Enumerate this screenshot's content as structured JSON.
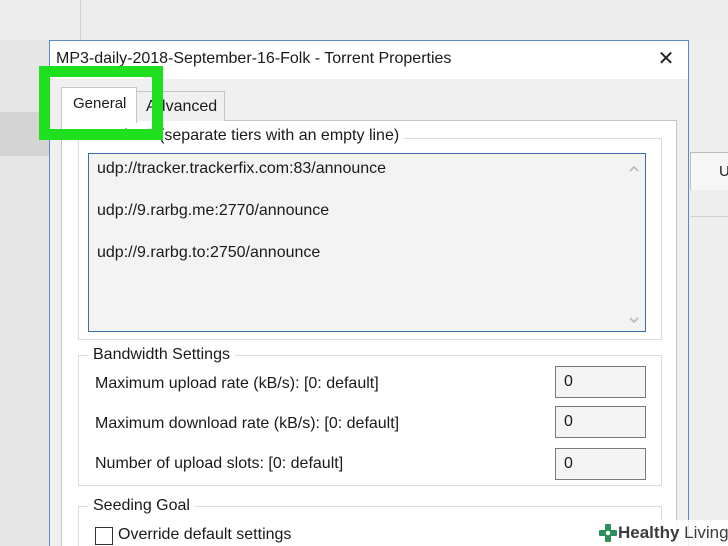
{
  "background": {
    "right_box_text": "U"
  },
  "dialog": {
    "title": "MP3-daily-2018-September-16-Folk - Torrent Properties",
    "close_glyph": "✕",
    "tabs": [
      {
        "label": "General",
        "selected": true
      },
      {
        "label": "Advanced",
        "selected": false
      }
    ]
  },
  "trackers": {
    "group_label": "Trackers (separate tiers with an empty line)",
    "lines": [
      "udp://tracker.trackerfix.com:83/announce",
      "udp://9.rarbg.me:2770/announce",
      "udp://9.rarbg.to:2750/announce"
    ]
  },
  "bandwidth": {
    "group_label": "Bandwidth Settings",
    "fields": [
      {
        "label": "Maximum upload rate (kB/s): [0: default]",
        "value": "0"
      },
      {
        "label": "Maximum download rate (kB/s): [0: default]",
        "value": "0"
      },
      {
        "label": "Number of upload slots: [0: default]",
        "value": "0"
      }
    ]
  },
  "seeding": {
    "group_label": "Seeding Goal",
    "override_label": "Override default settings",
    "override_checked": false
  },
  "watermark": {
    "bold": "Healthy",
    "light": " Living"
  },
  "colors": {
    "highlight": "#1fe01f",
    "dialog_border": "#5b8ac7",
    "tracker_border": "#3c6fa8",
    "watermark_icon": "#2f8f5a"
  },
  "icons": {
    "close": "close-icon",
    "scroll_up": "chevron-up-icon",
    "scroll_down": "chevron-down-icon",
    "watermark": "health-cross-icon"
  }
}
